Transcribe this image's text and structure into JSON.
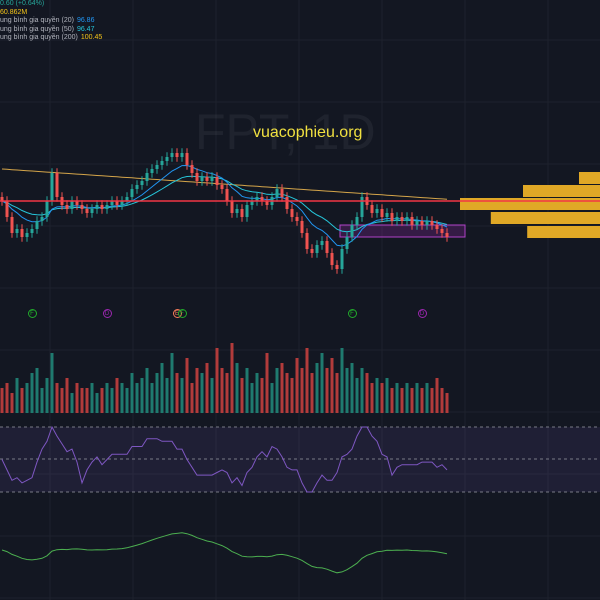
{
  "symbol_watermark": "FPT, 1D",
  "website": "vuacophieu.org",
  "legend": {
    "change": "0.60 (+0.64%)",
    "volume": "60.862M",
    "ma": [
      {
        "label": "ung bình gia quyền (20)",
        "value": "96.86",
        "color": "#2196f3"
      },
      {
        "label": "ung bình gia quyền (50)",
        "value": "96.47",
        "color": "#26c6da"
      },
      {
        "label": "ung bình gia quyền (200)",
        "value": "100.45",
        "color": "#f5c518"
      }
    ]
  },
  "events": [
    {
      "type": "F",
      "index": 6,
      "color": "#22ab2b"
    },
    {
      "type": "D",
      "index": 21,
      "color": "#9c27b0"
    },
    {
      "type": "E",
      "index": 35,
      "color": "#f77c5a"
    },
    {
      "type": "F",
      "index": 36,
      "color": "#22ab2b"
    },
    {
      "type": "F",
      "index": 70,
      "color": "#22ab2b"
    },
    {
      "type": "D",
      "index": 84,
      "color": "#9c27b0"
    }
  ],
  "chart_data": {
    "type": "candlestick",
    "title": "FPT, 1D",
    "closes": [
      100,
      96,
      92,
      93,
      91,
      92,
      93,
      95,
      96,
      100,
      107,
      101,
      99,
      98,
      100,
      99,
      98,
      97,
      98,
      99,
      98,
      99,
      100,
      99,
      100,
      101,
      103,
      104,
      105,
      107,
      108,
      109,
      110,
      111,
      112,
      111,
      112,
      109,
      107,
      105,
      106,
      105,
      106,
      104,
      103,
      100,
      97,
      98,
      96,
      99,
      100,
      101,
      100,
      99,
      101,
      103,
      101,
      98,
      96,
      95,
      92,
      88,
      87,
      89,
      90,
      87,
      84,
      83,
      88,
      91,
      94,
      96,
      101,
      99,
      97,
      98,
      96,
      97,
      95,
      96,
      95,
      96,
      94,
      95,
      94,
      95,
      94,
      93,
      92,
      91
    ],
    "volumes": [
      5,
      6,
      4,
      7,
      5,
      6,
      8,
      9,
      5,
      7,
      12,
      6,
      5,
      7,
      4,
      6,
      5,
      5,
      6,
      4,
      5,
      6,
      5,
      7,
      6,
      5,
      8,
      6,
      7,
      9,
      6,
      8,
      10,
      7,
      12,
      8,
      7,
      11,
      6,
      9,
      8,
      10,
      7,
      13,
      9,
      8,
      14,
      10,
      7,
      9,
      6,
      8,
      7,
      12,
      6,
      9,
      10,
      8,
      7,
      11,
      9,
      13,
      8,
      10,
      12,
      9,
      11,
      8,
      13,
      9,
      10,
      7,
      9,
      8,
      6,
      7,
      6,
      7,
      5,
      6,
      5,
      6,
      5,
      6,
      5,
      6,
      5,
      7,
      5,
      4
    ],
    "horizontal_line": 100,
    "zone": [
      91,
      94
    ],
    "volume_profile": [
      0.15,
      0.55,
      1.0,
      0.78,
      0.52
    ],
    "ylim": [
      79,
      115
    ]
  }
}
